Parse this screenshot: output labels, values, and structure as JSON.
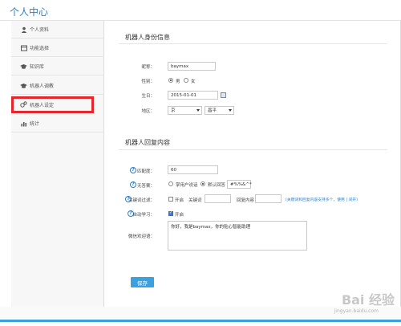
{
  "header": {
    "title": "个人中心"
  },
  "sidebar": {
    "items": [
      {
        "label": "个人资料",
        "icon": "user-icon"
      },
      {
        "label": "功能选择",
        "icon": "grid-icon"
      },
      {
        "label": "知识库",
        "icon": "graduation-cap-icon"
      },
      {
        "label": "机器人调教",
        "icon": "graduation-cap-icon"
      },
      {
        "label": "机器人设定",
        "icon": "gears-icon"
      },
      {
        "label": "统计",
        "icon": "bar-chart-icon"
      }
    ],
    "highlight_color": "#e5262b"
  },
  "identity": {
    "title": "机器人身份信息",
    "nickname_label": "昵称：",
    "nickname_value": "baymax",
    "gender_label": "性别：",
    "gender_male": "男",
    "gender_female": "女",
    "birthday_label": "生日：",
    "birthday_value": "2015-01-01",
    "region_label": "地区：",
    "region_province": "京",
    "region_city": "昌平"
  },
  "reply": {
    "title": "机器人回复内容",
    "match_label": "匹配度：",
    "match_value": "60",
    "no_answer_label": "无答案：",
    "no_answer_opt1": "掌用户说话",
    "no_answer_opt2": "默认回答",
    "no_answer_default": "#%%&^*",
    "keyword_filter_label": "关键词过滤：",
    "keyword_filter_open": "开启",
    "keyword_label": "关键词",
    "reply_content_label": "回复内容",
    "keyword_hint": "(关键词和回复内容支持多个，使用 | 间开)",
    "auto_learn_label": "自动学习：",
    "auto_learn_open": "开启",
    "welcome_label": "微信欢迎语：",
    "welcome_value": "你好，我是baymax，你的贴心智能助理",
    "save_label": "保存"
  },
  "watermark": {
    "text": "Bai 经验",
    "sub": "jingyan.baidu.com"
  },
  "colors": {
    "accent": "#2a7fc9",
    "button": "#3aa0e0"
  }
}
